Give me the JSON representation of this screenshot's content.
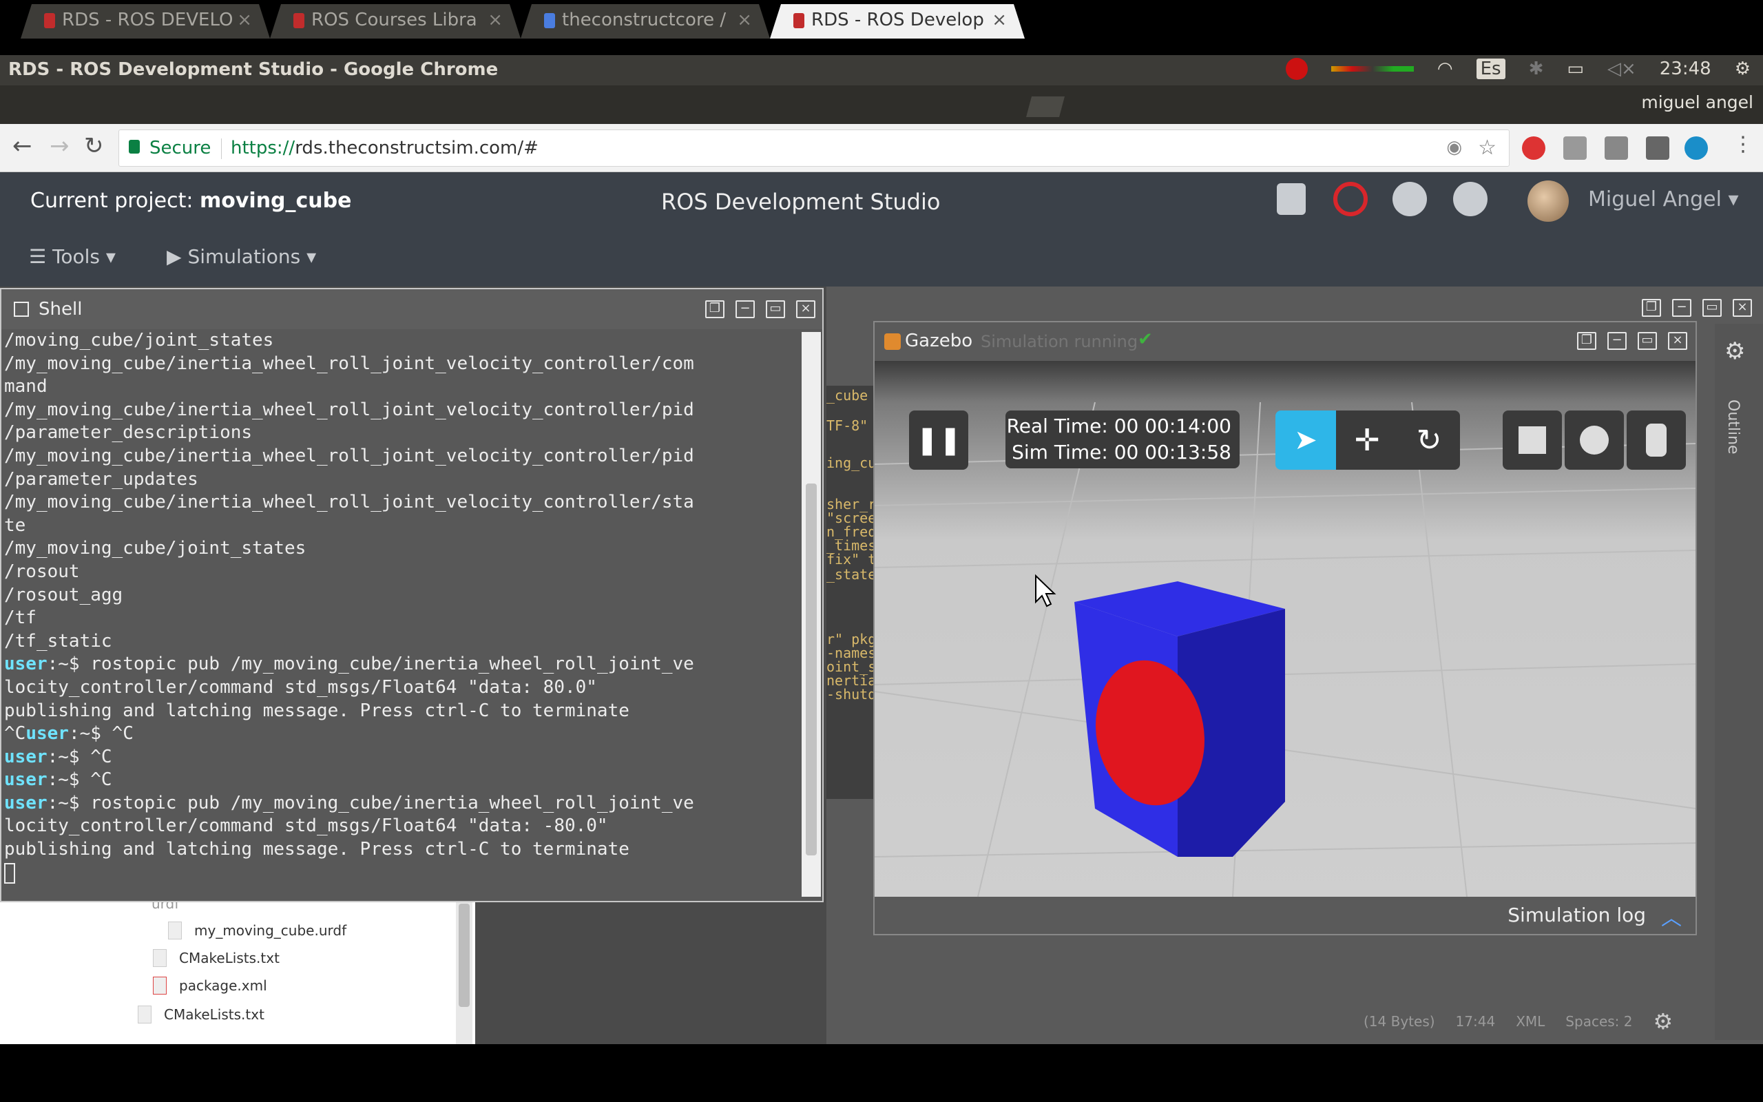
{
  "os": {
    "window_title": "RDS - ROS Development Studio - Google Chrome",
    "clock": "23:48",
    "keyboard_layout": "Es"
  },
  "browser": {
    "tabs": [
      {
        "label": "RDS - ROS DEVELO",
        "active": false
      },
      {
        "label": "ROS Courses Libra",
        "active": false
      },
      {
        "label": "theconstructcore /",
        "active": false
      },
      {
        "label": "RDS - ROS Develop",
        "active": true
      }
    ],
    "profile": "miguel angel",
    "secure_label": "Secure",
    "url_scheme": "https://",
    "url_rest": "rds.theconstructsim.com/#"
  },
  "app": {
    "project_label": "Current project: ",
    "project_name": "moving_cube",
    "title": "ROS Development Studio",
    "user_name": "Miguel Angel",
    "menu": {
      "tools": "Tools",
      "simulations": "Simulations"
    }
  },
  "shell": {
    "title": "Shell",
    "lines": [
      {
        "prompt": "",
        "text": "/moving_cube/joint_states"
      },
      {
        "prompt": "",
        "text": "/my_moving_cube/inertia_wheel_roll_joint_velocity_controller/com"
      },
      {
        "prompt": "",
        "text": "mand"
      },
      {
        "prompt": "",
        "text": "/my_moving_cube/inertia_wheel_roll_joint_velocity_controller/pid"
      },
      {
        "prompt": "",
        "text": "/parameter_descriptions"
      },
      {
        "prompt": "",
        "text": "/my_moving_cube/inertia_wheel_roll_joint_velocity_controller/pid"
      },
      {
        "prompt": "",
        "text": "/parameter_updates"
      },
      {
        "prompt": "",
        "text": "/my_moving_cube/inertia_wheel_roll_joint_velocity_controller/sta"
      },
      {
        "prompt": "",
        "text": "te"
      },
      {
        "prompt": "",
        "text": "/my_moving_cube/joint_states"
      },
      {
        "prompt": "",
        "text": "/rosout"
      },
      {
        "prompt": "",
        "text": "/rosout_agg"
      },
      {
        "prompt": "",
        "text": "/tf"
      },
      {
        "prompt": "",
        "text": "/tf_static"
      },
      {
        "prompt": "user",
        "text": ":~$ rostopic pub /my_moving_cube/inertia_wheel_roll_joint_ve"
      },
      {
        "prompt": "",
        "text": "locity_controller/command std_msgs/Float64 \"data: 80.0\""
      },
      {
        "prompt": "",
        "text": "publishing and latching message. Press ctrl-C to terminate"
      },
      {
        "prompt": "^Cuser",
        "text": ":~$ ^C"
      },
      {
        "prompt": "user",
        "text": ":~$ ^C"
      },
      {
        "prompt": "user",
        "text": ":~$ ^C"
      },
      {
        "prompt": "user",
        "text": ":~$ rostopic pub /my_moving_cube/inertia_wheel_roll_joint_ve"
      },
      {
        "prompt": "",
        "text": "locity_controller/command std_msgs/Float64 \"data: -80.0\""
      },
      {
        "prompt": "",
        "text": "publishing and latching message. Press ctrl-C to terminate"
      }
    ]
  },
  "editor_fragments": [
    "_cube",
    "TF-8\"",
    "ing_cu",
    "sher_r",
    "\"scree",
    "n_freq",
    "_times",
    "fix\" t",
    "_state",
    "r\" pkg",
    "-names",
    "oint_s",
    "nertia",
    "-shutd"
  ],
  "file_tree": [
    {
      "name": "urdf"
    },
    {
      "name": "my_moving_cube.urdf"
    },
    {
      "name": "CMakeLists.txt"
    },
    {
      "name": "package.xml"
    },
    {
      "name": "CMakeLists.txt"
    }
  ],
  "status": {
    "size": "(14 Bytes)",
    "position": "17:44",
    "mode": "XML",
    "spaces": "Spaces: 2"
  },
  "gazebo": {
    "title": "Gazebo",
    "status": "Simulation running",
    "real_time": "Real Time: 00 00:14:00",
    "sim_time": "Sim Time: 00 00:13:58",
    "log_label": "Simulation log"
  },
  "outline_label": "Outline",
  "colors": {
    "cube": "#2f2ee6",
    "cube_dark": "#1d1ca8",
    "circle": "#e0161f",
    "select_tool": "#2eb6e8"
  }
}
